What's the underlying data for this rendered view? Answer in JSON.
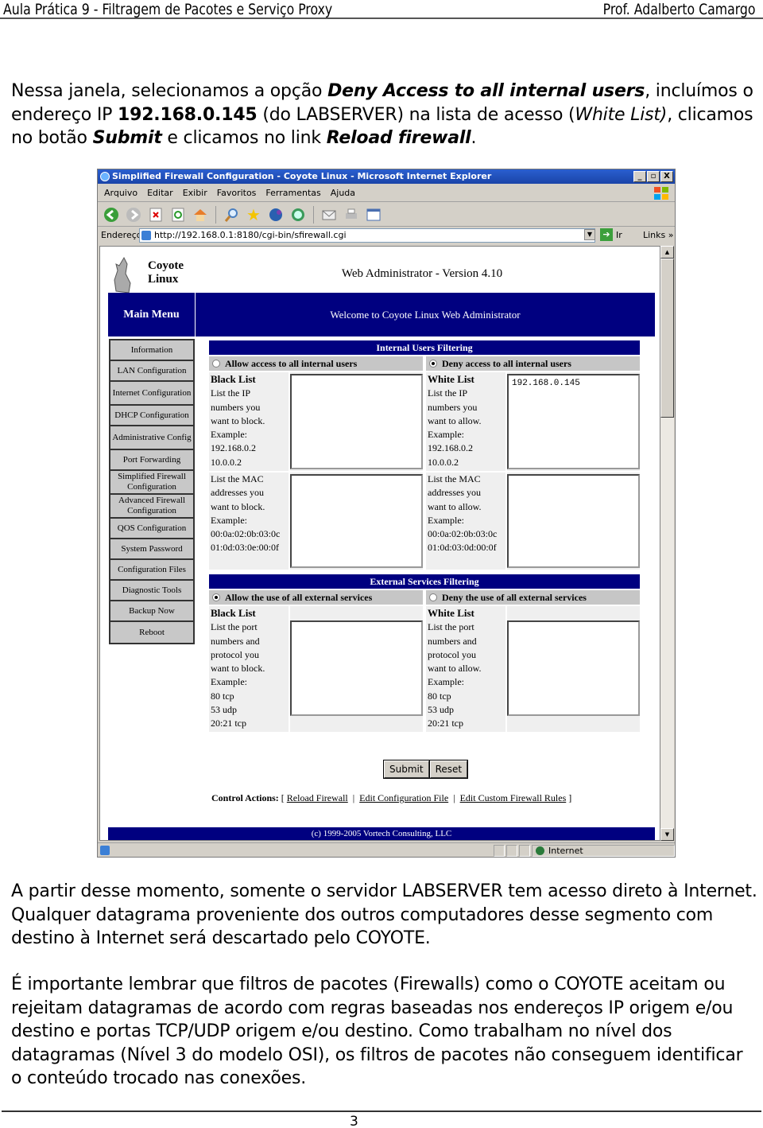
{
  "doc_header": {
    "left": "Aula Prática 9 - Filtragem de Pacotes e Serviço Proxy",
    "right": "Prof. Adalberto Camargo"
  },
  "intro": {
    "t1": "Nessa janela, selecionamos a opção ",
    "b1": "Deny Access to all internal users",
    "t2": ", incluímos o endereço IP ",
    "b2": "192.168.0.145",
    "t3": " (do LABSERVER) na lista de acesso (",
    "i1": "White List)",
    "t4": ", clicamos no botão ",
    "b3": "Submit",
    "t5": " e clicamos no link ",
    "b4": "Reload firewall",
    "t6": "."
  },
  "browser": {
    "title": "Simplified Firewall Configuration - Coyote Linux - Microsoft Internet Explorer",
    "window_buttons": [
      "_",
      "▫",
      "X"
    ],
    "menu": [
      "Arquivo",
      "Editar",
      "Exibir",
      "Favoritos",
      "Ferramentas",
      "Ajuda"
    ],
    "toolbar_icons": [
      "back-icon",
      "forward-icon",
      "stop-icon",
      "refresh-icon",
      "home-icon",
      "search-icon",
      "favorites-icon",
      "media-icon",
      "history-icon",
      "mail-icon",
      "print-icon",
      "edit-icon"
    ],
    "address_label": "Endereço",
    "url": "http://192.168.0.1:8180/cgi-bin/sfirewall.cgi",
    "go_label": "Ir",
    "links_label": "Links",
    "links_chevron": "»",
    "status_zone": "Internet",
    "scroll_position": 0.0
  },
  "coyote": {
    "logo_line1": "Coyote",
    "logo_line2": "Linux",
    "version": "Web Administrator - Version 4.10",
    "main_menu": "Main Menu",
    "welcome": "Welcome to Coyote Linux Web Administrator",
    "menu_items": [
      "Information",
      "LAN Configuration",
      "Internet Configuration",
      "DHCP Configuration",
      "Administrative Config",
      "Port Forwarding",
      "Simplified Firewall Configuration",
      "Advanced Firewall Configuration",
      "QOS Configuration",
      "System Password",
      "Configuration Files",
      "Diagnostic Tools",
      "Backup Now",
      "Reboot"
    ],
    "internal": {
      "title": "Internal Users Filtering",
      "allow_label": "Allow access to all internal users",
      "deny_label": "Deny access to all internal users",
      "selected": "deny",
      "black_ip": {
        "title": "Black List",
        "lines": [
          "List the IP",
          "numbers you",
          "want to block.",
          "Example:",
          "192.168.0.2",
          "10.0.0.2"
        ],
        "value": ""
      },
      "white_ip": {
        "title": "White List",
        "lines": [
          "List the IP",
          "numbers you",
          "want to allow.",
          "Example:",
          "192.168.0.2",
          "10.0.0.2"
        ],
        "value": "192.168.0.145"
      },
      "black_mac": {
        "lines": [
          "List the MAC",
          "addresses you",
          "want to block.",
          "Example:",
          "00:0a:02:0b:03:0c",
          "01:0d:03:0e:00:0f"
        ],
        "value": ""
      },
      "white_mac": {
        "lines": [
          "List the MAC",
          "addresses you",
          "want to allow.",
          "Example:",
          "00:0a:02:0b:03:0c",
          "01:0d:03:0d:00:0f"
        ],
        "value": ""
      }
    },
    "external": {
      "title": "External Services Filtering",
      "allow_label": "Allow the use of all external services",
      "deny_label": "Deny the use of all external services",
      "selected": "allow",
      "black": {
        "title": "Black List",
        "lines": [
          "List the port",
          "numbers and",
          "protocol you",
          "want to block.",
          "Example:",
          "80 tcp",
          "53 udp",
          "20:21 tcp"
        ],
        "value": ""
      },
      "white": {
        "title": "White List",
        "lines": [
          "List the port",
          "numbers and",
          "protocol you",
          "want to allow.",
          "Example:",
          "80 tcp",
          "53 udp",
          "20:21 tcp"
        ],
        "value": ""
      }
    },
    "submit_label": "Submit",
    "reset_label": "Reset",
    "control_actions_label": "Control Actions:",
    "control_links": [
      "Reload Firewall",
      "Edit Configuration File",
      "Edit Custom Firewall Rules"
    ],
    "copyright": "(c) 1999-2005 Vortech Consulting, LLC"
  },
  "para2": "A partir desse momento, somente o servidor LABSERVER tem acesso direto à Internet. Qualquer datagrama proveniente dos outros computadores desse segmento com destino à Internet será descartado pelo COYOTE.",
  "para3": "É importante lembrar que filtros de pacotes (Firewalls) como o COYOTE aceitam ou rejeitam datagramas de acordo com regras baseadas nos endereços IP origem e/ou destino e portas TCP/UDP origem e/ou destino. Como trabalham no nível dos datagramas (Nível 3 do modelo OSI), os filtros de pacotes não conseguem identificar o conteúdo trocado nas conexões.",
  "page_number": "3"
}
